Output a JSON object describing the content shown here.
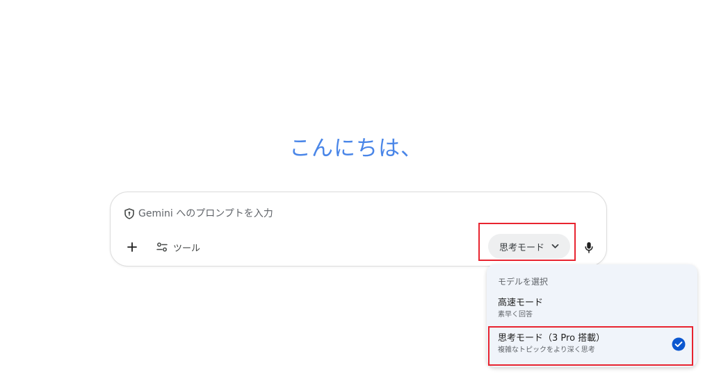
{
  "greeting": "こんにちは、",
  "composer": {
    "placeholder": "Gemini へのプロンプトを入力",
    "tools_label": "ツール",
    "mode_label": "思考モード"
  },
  "model_menu": {
    "header": "モデルを選択",
    "items": [
      {
        "title": "高速モード",
        "subtitle": "素早く回答",
        "selected": false
      },
      {
        "title": "思考モード（3 Pro 搭載）",
        "subtitle": "複雑なトピックをより深く思考",
        "selected": true
      }
    ]
  },
  "icons": {
    "shield": "shield-icon",
    "plus": "plus-icon",
    "tools": "tune-icon",
    "chevron": "chevron-down-icon",
    "mic": "microphone-icon",
    "check": "check-circle-icon"
  },
  "colors": {
    "greeting": "#4a86e8",
    "check": "#0b57d0",
    "highlight": "#e8232f",
    "menu_bg": "#f0f4fa",
    "mode_button_bg": "#eeeff0"
  }
}
